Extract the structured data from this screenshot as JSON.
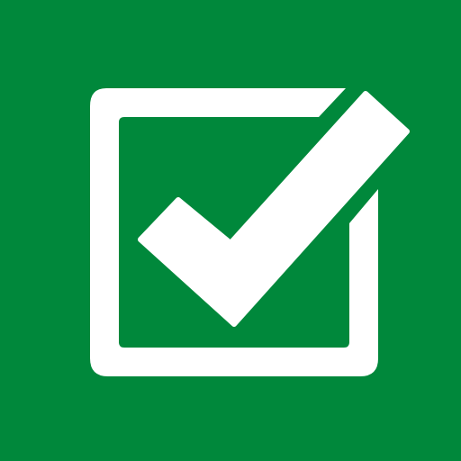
{
  "icon": {
    "name": "checked-checkbox-icon",
    "background_color": "#00883B",
    "foreground_color": "#FFFFFF",
    "checked": true
  }
}
